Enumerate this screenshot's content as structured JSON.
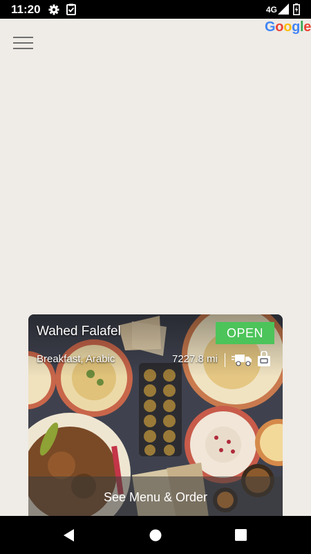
{
  "status_bar": {
    "time": "11:20",
    "network": "4G",
    "icons": [
      "gear-icon",
      "clipboard-check-icon",
      "signal-icon",
      "battery-icon"
    ]
  },
  "header": {
    "menu_icon": "hamburger-menu-icon",
    "logo": {
      "letters": [
        "G",
        "o",
        "o",
        "g",
        "l",
        "e"
      ],
      "colors": [
        "#4285f4",
        "#ea4335",
        "#fbbc05",
        "#4285f4",
        "#34a853",
        "#ea4335"
      ]
    }
  },
  "restaurant_card": {
    "name": "Wahed Falafel",
    "status": "OPEN",
    "status_color": "#4cc45a",
    "categories": "Breakfast, Arabic",
    "distance": "7227.8 mi",
    "service_icons": [
      "delivery-truck-icon",
      "takeaway-bag-icon"
    ],
    "action_label": "See Menu & Order"
  },
  "nav_bar": {
    "icons": [
      "back-icon",
      "home-icon",
      "recent-apps-icon"
    ]
  }
}
